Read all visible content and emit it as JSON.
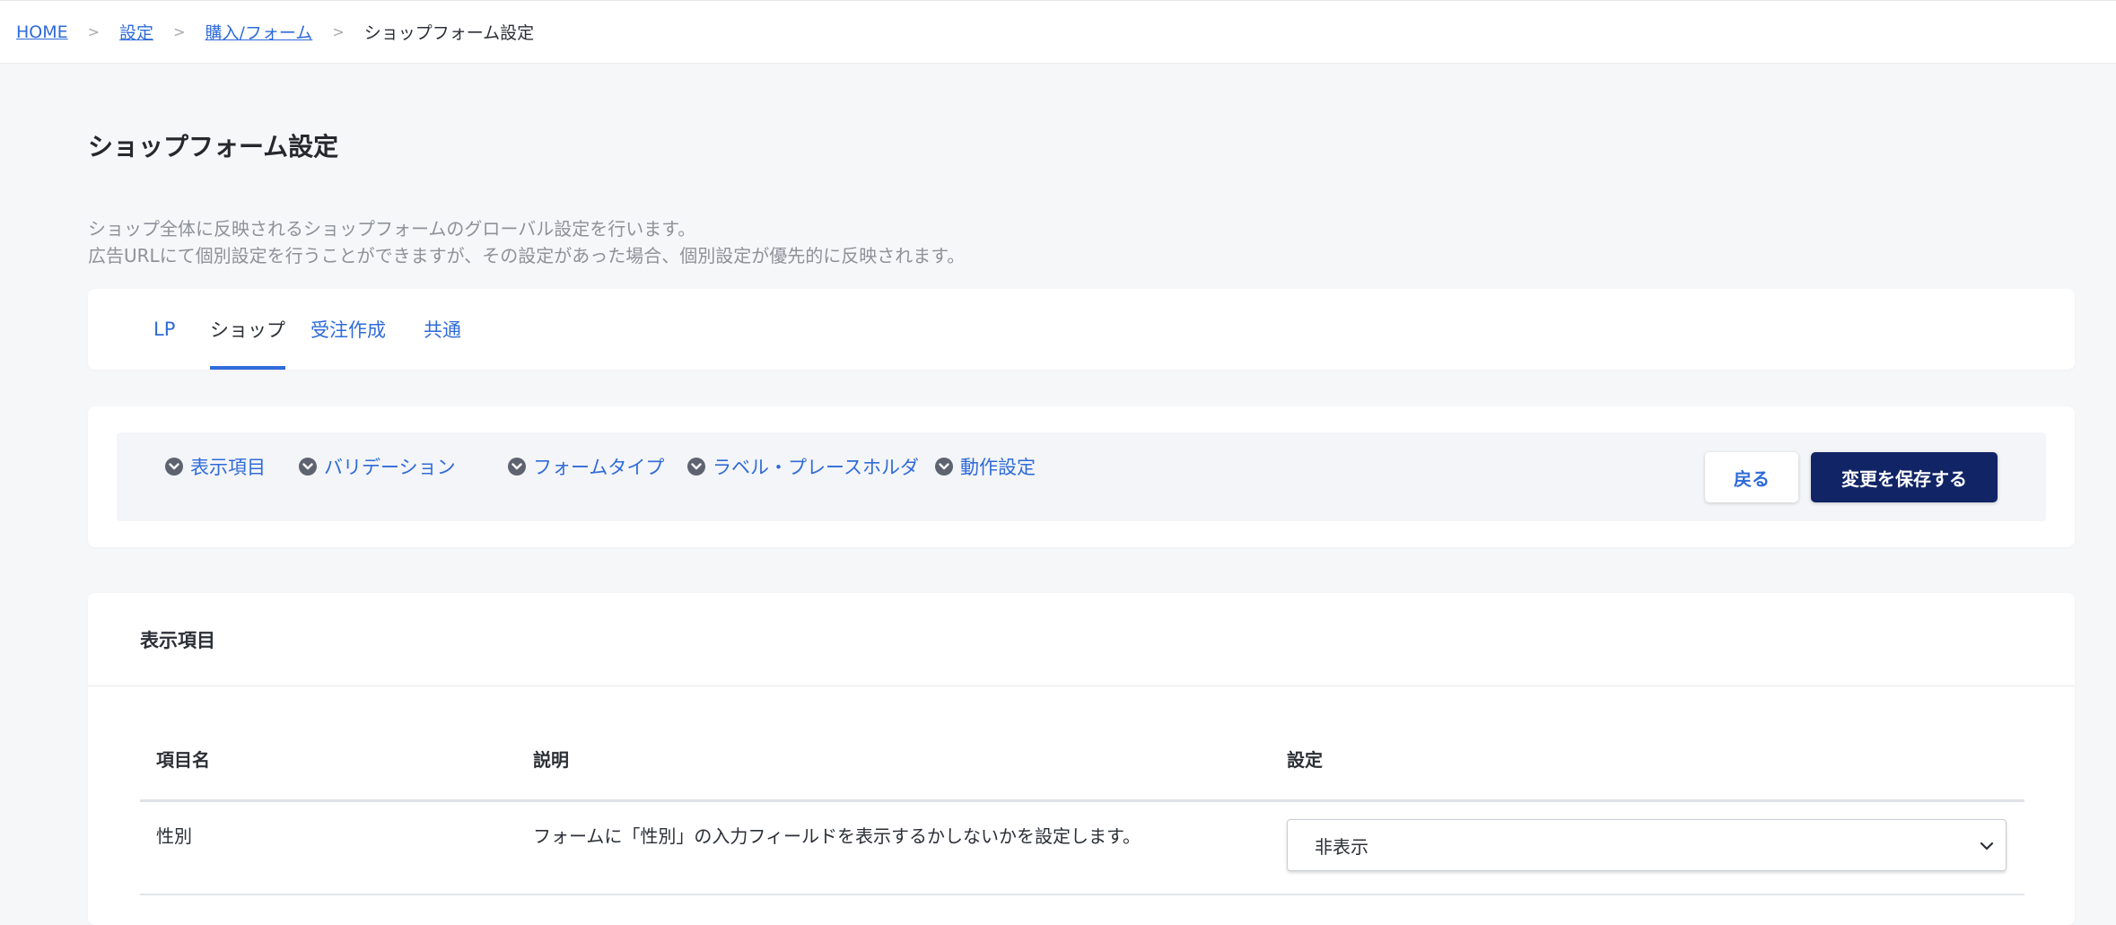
{
  "breadcrumb": {
    "home": "HOME",
    "settings": "設定",
    "purchase_form": "購入/フォーム",
    "current": "ショップフォーム設定",
    "separator": ">"
  },
  "page": {
    "title": "ショップフォーム設定",
    "description_line1": "ショップ全体に反映されるショップフォームのグローバル設定を行います。",
    "description_line2": "広告URLにて個別設定を行うことができますが、その設定があった場合、個別設定が優先的に反映されます。"
  },
  "tabs": [
    {
      "label": "LP",
      "active": false
    },
    {
      "label": "ショップ",
      "active": true
    },
    {
      "label": "受注作成",
      "active": false
    },
    {
      "label": "共通",
      "active": false
    }
  ],
  "anchors": [
    {
      "label": "表示項目"
    },
    {
      "label": "バリデーション"
    },
    {
      "label": "フォームタイプ"
    },
    {
      "label": "ラベル・プレースホルダ"
    },
    {
      "label": "動作設定"
    }
  ],
  "actions": {
    "back_label": "戻る",
    "save_label": "変更を保存する"
  },
  "section": {
    "title": "表示項目",
    "columns": {
      "name": "項目名",
      "description": "説明",
      "setting": "設定"
    },
    "rows": [
      {
        "name": "性別",
        "description": "フォームに「性別」の入力フィールドを表示するかしないかを設定します。",
        "setting": "非表示"
      }
    ]
  },
  "colors": {
    "link": "#2f6bd9",
    "primary_button": "#102466",
    "background": "#f6f7f9"
  }
}
